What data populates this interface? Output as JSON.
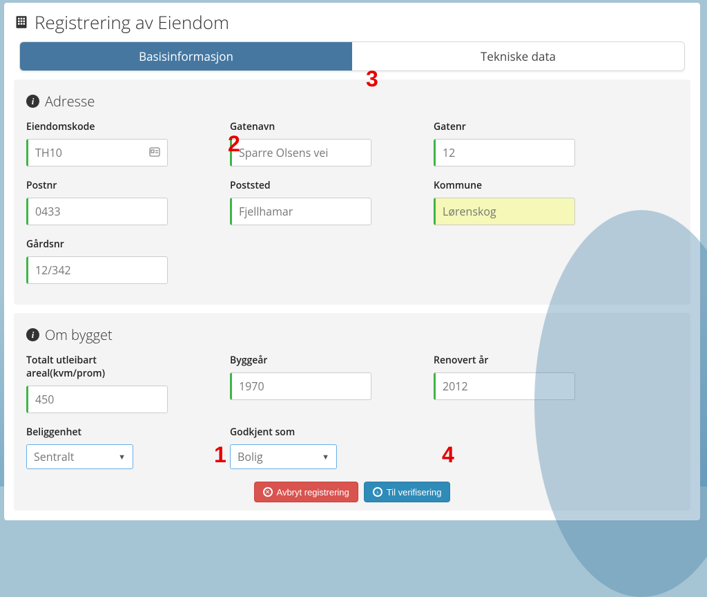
{
  "page": {
    "title": "Registrering av Eiendom"
  },
  "tabs": {
    "basic": "Basisinformasjon",
    "tech": "Tekniske data"
  },
  "sections": {
    "adresse": {
      "title": "Adresse"
    },
    "bygg": {
      "title": "Om bygget"
    }
  },
  "fields": {
    "eiendomskode": {
      "label": "Eiendomskode",
      "value": "TH10"
    },
    "gatenavn": {
      "label": "Gatenavn",
      "value": "Sparre Olsens vei"
    },
    "gatenr": {
      "label": "Gatenr",
      "value": "12"
    },
    "postnr": {
      "label": "Postnr",
      "value": "0433"
    },
    "poststed": {
      "label": "Poststed",
      "value": "Fjellhamar"
    },
    "kommune": {
      "label": "Kommune",
      "value": "Lørenskog"
    },
    "gardsnr": {
      "label": "Gårdsnr",
      "value": "12/342"
    },
    "areal": {
      "label": "Totalt utleibart areal(kvm/prom)",
      "value": "450"
    },
    "byggear": {
      "label": "Byggeår",
      "value": "1970"
    },
    "renovert": {
      "label": "Renovert år",
      "value": "2012"
    },
    "beliggenhet": {
      "label": "Beliggenhet",
      "value": "Sentralt"
    },
    "godkjent": {
      "label": "Godkjent som",
      "value": "Bolig"
    }
  },
  "buttons": {
    "cancel": "Avbryt registrering",
    "next": "Til verifisering"
  },
  "annotations": {
    "a1": "1",
    "a2": "2",
    "a3": "3",
    "a4": "4"
  }
}
